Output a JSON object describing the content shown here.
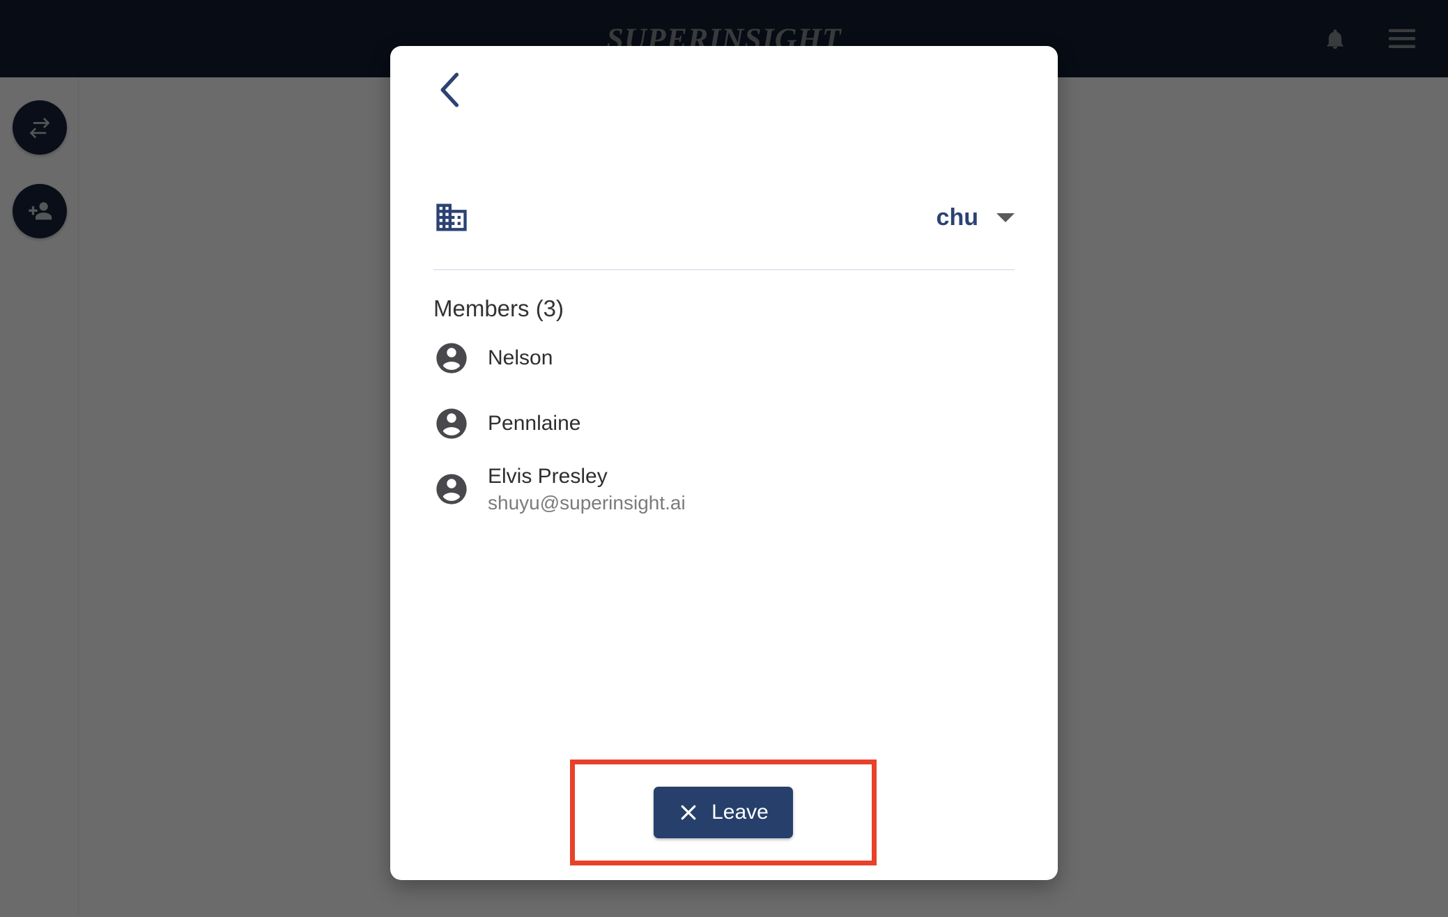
{
  "topbar": {
    "brand": "SUPERINSIGHT",
    "notifications_icon": "bell-icon",
    "menu_icon": "hamburger-menu-icon",
    "background_color": "#111E33",
    "brand_color": "#8A8C8F"
  },
  "rail": {
    "buttons": [
      {
        "name": "swap-horizontal-icon",
        "label": ""
      },
      {
        "name": "person-add-icon",
        "label": ""
      }
    ],
    "button_color": "#16233A"
  },
  "dialog": {
    "back_icon": "chevron-left-icon",
    "workspace_icon": "domain-building-icon",
    "workspace_name": "chu",
    "workspace_caret_icon": "caret-down-icon",
    "members_heading": "Members (3)",
    "members": [
      {
        "name": "Nelson",
        "email": ""
      },
      {
        "name": "Pennlaine",
        "email": ""
      },
      {
        "name": "Elvis Presley",
        "email": "shuyu@superinsight.ai"
      }
    ],
    "leave": {
      "label": "Leave",
      "icon": "close-x-icon",
      "button_color": "#26406B",
      "highlight_color": "#E8412A"
    },
    "accent_color": "#2C4273",
    "divider_color": "#E6E7EF"
  }
}
